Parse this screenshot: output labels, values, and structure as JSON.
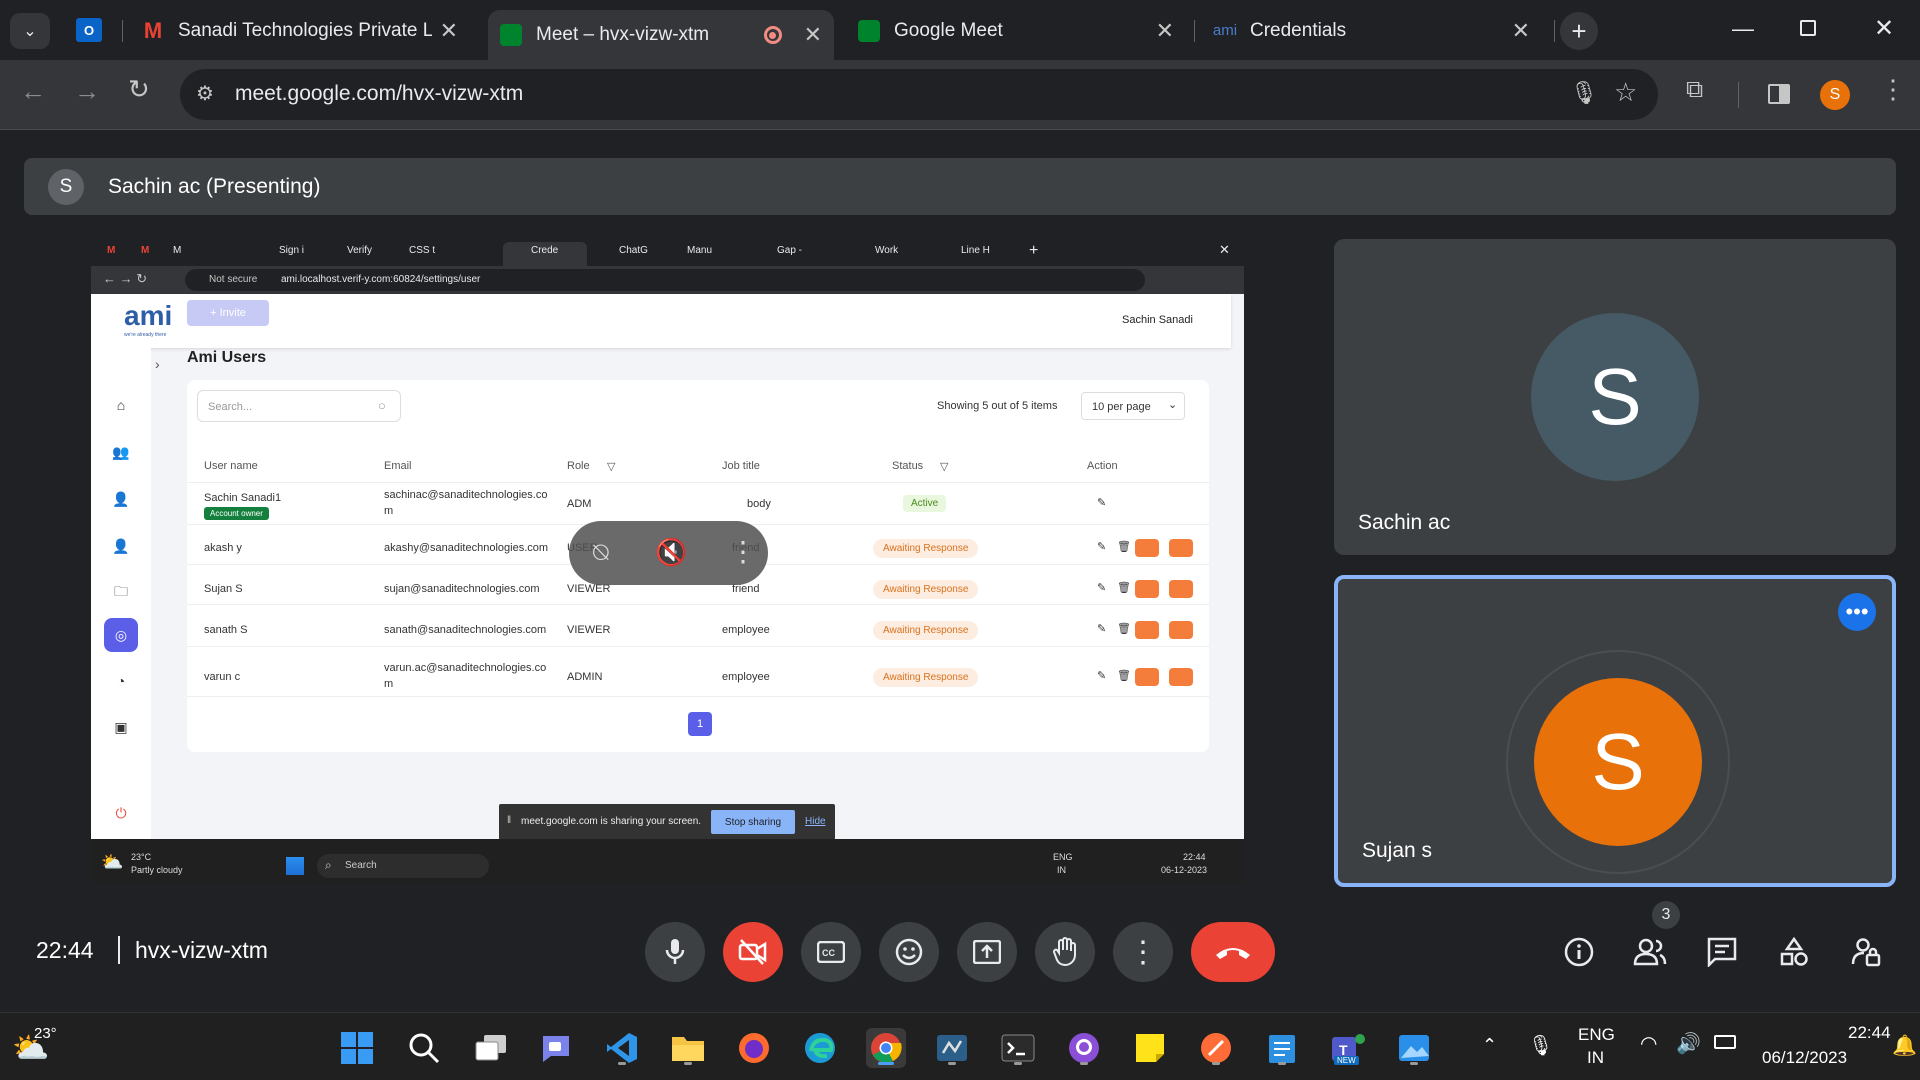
{
  "browser": {
    "tabs": [
      {
        "title": "Sanadi Technologies Private Lir",
        "icon": "gmail-icon"
      },
      {
        "title": "Meet – hvx-vizw-xtm",
        "icon": "meet-icon"
      },
      {
        "title": "Google Meet",
        "icon": "meet-icon"
      },
      {
        "title": "Credentials",
        "icon": "ami-icon",
        "icon_text": "ami"
      }
    ],
    "url": "meet.google.com/hvx-vizw-xtm",
    "profile_initial": "S"
  },
  "meet": {
    "presenter_initial": "S",
    "presenter_label": "Sachin ac (Presenting)",
    "time": "22:44",
    "meeting_code": "hvx-vizw-xtm",
    "participants_count": "3",
    "tiles": [
      {
        "initial": "S",
        "name": "Sachin ac",
        "color": "#455a64"
      },
      {
        "initial": "S",
        "name": "Sujan s",
        "color": "#e8710a"
      }
    ]
  },
  "shared_screen": {
    "tabs": [
      "M",
      "M",
      "M",
      "Sign i",
      "Verify",
      "CSS t",
      "Crede",
      "ChatG",
      "Manu",
      "Gap -",
      "Work",
      "Line H"
    ],
    "security": "Not secure",
    "url": "ami.localhost.verif-y.com:60824/settings/user",
    "logo": "ami",
    "logo_tagline": "we're already there",
    "user": "Sachin Sanadi",
    "invite_label": "+ Invite",
    "page_title": "Ami Users",
    "search_placeholder": "Search...",
    "showing": "Showing 5 out of 5 items",
    "per_page": "10 per page",
    "columns": [
      "User name",
      "Email",
      "Role",
      "Job title",
      "Status",
      "Action"
    ],
    "rows": [
      {
        "name": "Sachin Sanadi1",
        "owner": "Account owner",
        "email": "sachinac@sanaditechnologies.co",
        "email2": "m",
        "role": "ADM",
        "job": "body",
        "status": "Active"
      },
      {
        "name": "akash y",
        "email": "akashy@sanaditechnologies.com",
        "role": "USER",
        "job": "friend",
        "status": "Awaiting Response"
      },
      {
        "name": "Sujan S",
        "email": "sujan@sanaditechnologies.com",
        "role": "VIEWER",
        "job": "friend",
        "status": "Awaiting Response"
      },
      {
        "name": "sanath S",
        "email": "sanath@sanaditechnologies.com",
        "role": "VIEWER",
        "job": "employee",
        "status": "Awaiting Response"
      },
      {
        "name": "varun c",
        "email": "varun.ac@sanaditechnologies.co",
        "email2": "m",
        "role": "ADMIN",
        "job": "employee",
        "status": "Awaiting Response"
      }
    ],
    "page": "1",
    "sharing_text": "meet.google.com is sharing your screen.",
    "stop_sharing": "Stop sharing",
    "hide": "Hide",
    "taskbar_weather_temp": "23°C",
    "taskbar_weather_desc": "Partly cloudy",
    "taskbar_search": "Search",
    "taskbar_lang": "ENG",
    "taskbar_region": "IN",
    "taskbar_time": "22:44",
    "taskbar_date": "06-12-2023"
  },
  "taskbar": {
    "weather_temp": "23°",
    "lang": "ENG",
    "region": "IN",
    "time": "22:44",
    "date": "06/12/2023",
    "new_badge": "NEW"
  }
}
